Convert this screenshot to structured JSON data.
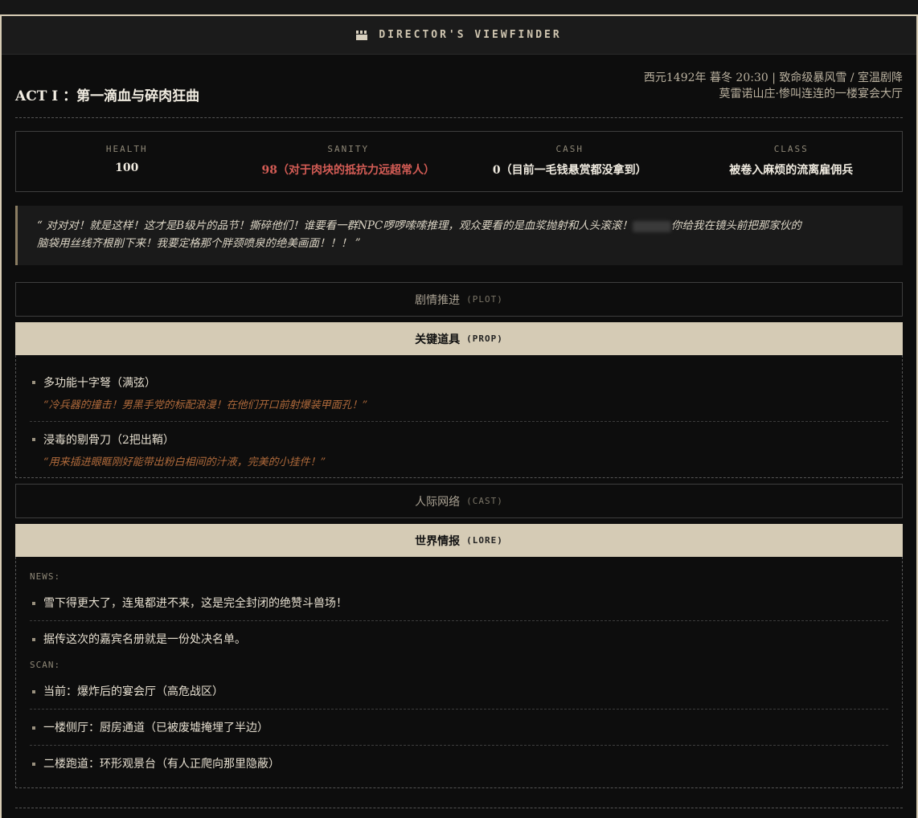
{
  "window": {
    "title": "DIRECTOR'S VIEWFINDER",
    "icon": "clapperboard-icon"
  },
  "header": {
    "act_title": "ACT I ：第一滴血与碎肉狂曲",
    "time_weather": "西元1492年 暮冬 20:30 | 致命级暴风雪 / 室温剧降",
    "location": "莫雷诺山庄·惨叫连连的一楼宴会大厅"
  },
  "stats": [
    {
      "label": "HEALTH",
      "value": "100"
    },
    {
      "label": "SANITY",
      "value": "98（对于肉块的抵抗力远超常人）"
    },
    {
      "label": "CASH",
      "value": "0（目前一毛钱悬赏都没拿到）"
    },
    {
      "label": "CLASS",
      "value": "被卷入麻烦的流离雇佣兵"
    }
  ],
  "quote": {
    "line1": "“ 对对对！就是这样！这才是B级片的品节！撕碎他们！谁要看一群NPC啰啰嗦嗦推理，观众要看的是血浆抛射和人头滚滚！",
    "line1_end": "你给我在镜头前把那家伙的",
    "line2": "脑袋用丝线齐根削下来！我要定格那个胖颈喷泉的绝美画面！！！ ”"
  },
  "sections": {
    "plot": {
      "label": "剧情推进",
      "en": "(PLOT)"
    },
    "prop": {
      "label": "关键道具",
      "en": "(PROP)"
    },
    "cast": {
      "label": "人际网络",
      "en": "(CAST)"
    },
    "lore": {
      "label": "世界情报",
      "en": "(LORE)"
    }
  },
  "props": [
    {
      "name": "多功能十字弩（满弦）",
      "note": "“冷兵器的撞击！男黑手党的标配浪漫！在他们开口前射爆装甲面孔！”"
    },
    {
      "name": "浸毒的剔骨刀（2把出鞘）",
      "note": "“用来插进眼眶刚好能带出粉白相间的汁液，完美的小挂件！”"
    }
  ],
  "lore": {
    "news_tag": "NEWS:",
    "news": [
      "雪下得更大了，连鬼都进不来，这是完全封闭的绝赞斗兽场！",
      "据传这次的嘉宾名册就是一份处决名单。"
    ],
    "scan_tag": "SCAN:",
    "scan": [
      "当前：爆炸后的宴会厅（高危战区）",
      "一楼侧厅：厨房通道（已被废墟掩埋了半边）",
      "二楼跑道：环形观景台（有人正爬向那里隐蔽）"
    ]
  }
}
